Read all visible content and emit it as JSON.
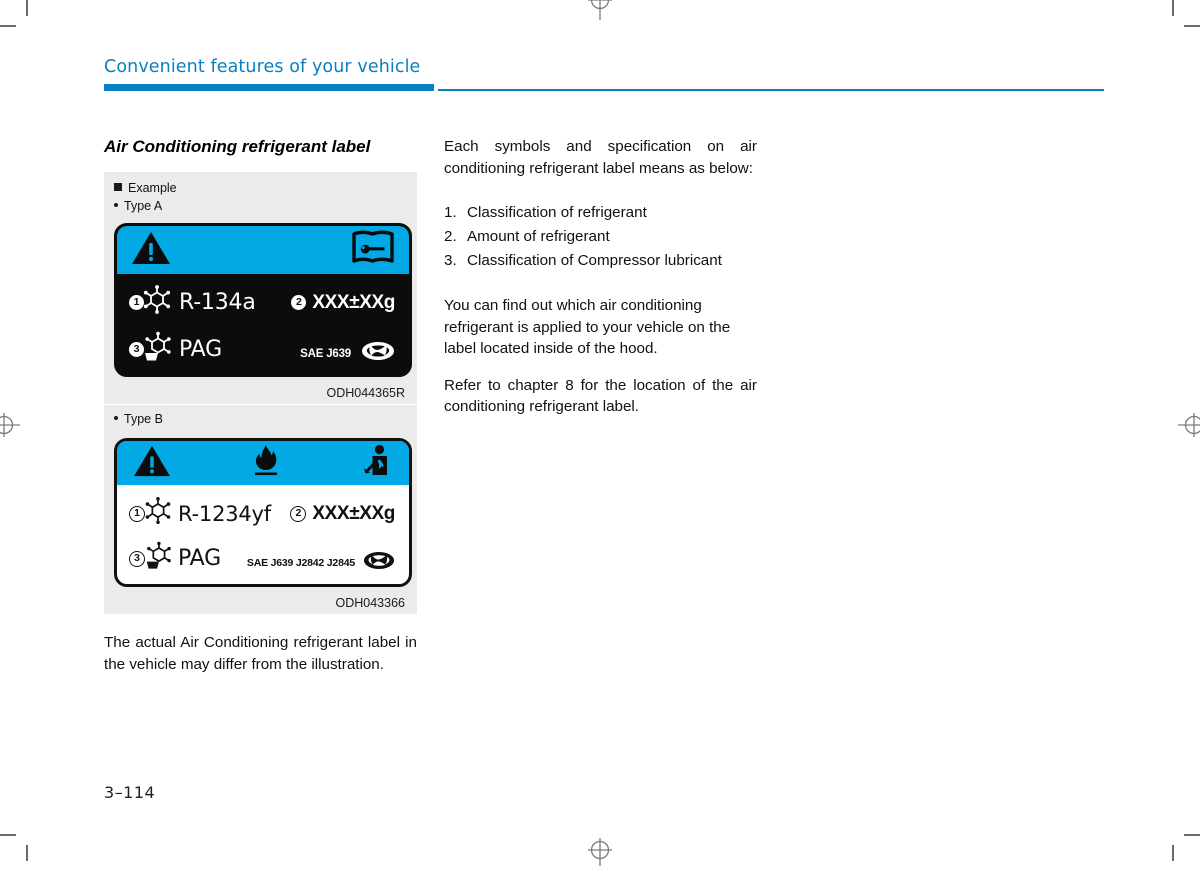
{
  "document": {
    "chapter_header": "Convenient features of your vehicle",
    "page_number": "3–114",
    "ghost_header_text": "",
    "ghost_side_text": ""
  },
  "left_column": {
    "section_title": "Air Conditioning refrigerant label",
    "example_label": "Example",
    "type_a_label": "Type A",
    "type_b_label": "Type B",
    "figure_a_code": "ODH044365R",
    "figure_b_code": "ODH043366",
    "closing_note": "The actual Air Conditioning refrigerant label in the vehicle may differ from the illustration."
  },
  "right_column": {
    "intro": "Each symbols and specification on air conditioning refrigerant label means as below:",
    "numbered_items": [
      {
        "num": "1.",
        "text": "Classification of refrigerant"
      },
      {
        "num": "2.",
        "text": "Amount of refrigerant"
      },
      {
        "num": "3.",
        "text": "Classification of Compressor lubricant"
      }
    ],
    "paragraph_2": "You can find out which air conditioning refrigerant is applied to your vehicle on the label located inside of the hood.",
    "paragraph_3": "Refer to chapter 8 for the location of the air conditioning refrigerant label."
  },
  "label_type_a": {
    "header_icons": [
      "warning-triangle-icon",
      "service-manual-book-icon"
    ],
    "item1_badge": "1",
    "item1_icon": "refrigerant-molecule-icon",
    "item1_value": "R-134a",
    "item2_badge": "2",
    "item2_value": "XXX±XXg",
    "item3_badge": "3",
    "item3_icon": "lubricant-molecule-icon",
    "item3_value": "PAG",
    "standard": "SAE J639",
    "brand_icon": "hyundai-logo-icon"
  },
  "label_type_b": {
    "header_icons": [
      "warning-triangle-icon",
      "flammable-flame-icon",
      "health-hazard-icon"
    ],
    "item1_badge": "1",
    "item1_icon": "refrigerant-molecule-icon",
    "item1_value": "R-1234yf",
    "item2_badge": "2",
    "item2_value": "XXX±XXg",
    "item3_badge": "3",
    "item3_icon": "lubricant-molecule-icon",
    "item3_value": "PAG",
    "standard": "SAE J639 J2842 J2845",
    "brand_icon": "hyundai-logo-icon"
  },
  "colors": {
    "accent_blue": "#0b7fc4",
    "label_blue": "#02a9e5",
    "label_dark": "#0c0c0c",
    "panel_grey": "#ebebeb"
  }
}
